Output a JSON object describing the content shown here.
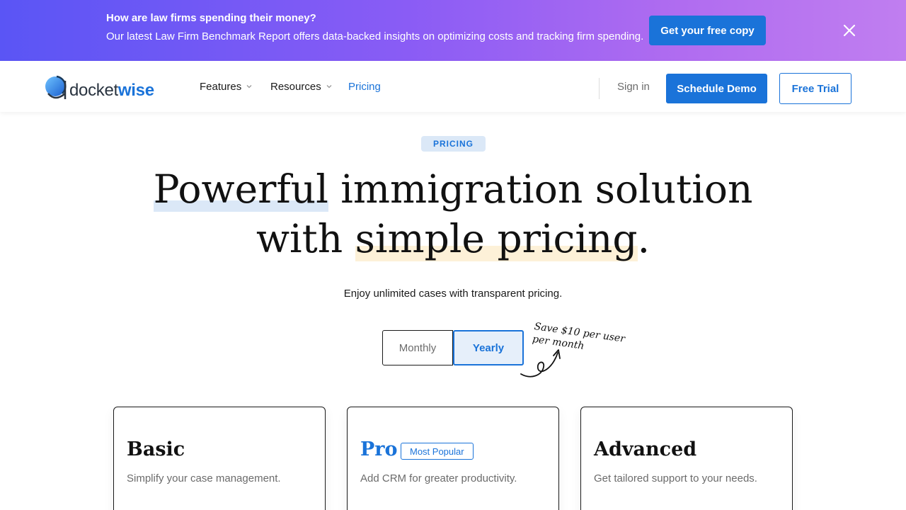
{
  "banner": {
    "title": "How are law firms spending their money?",
    "subtitle": "Our latest Law Firm Benchmark Report offers data-backed insights on optimizing costs and tracking firm spending.",
    "cta": "Get your free copy",
    "close_icon": "close-icon",
    "gradient_start": "#5a55f5",
    "gradient_end": "#c07ef0"
  },
  "header": {
    "logo": {
      "part1": "docket",
      "part2": "wise"
    },
    "nav": [
      {
        "label": "Features",
        "has_dropdown": true
      },
      {
        "label": "Resources",
        "has_dropdown": true
      },
      {
        "label": "Pricing",
        "has_dropdown": false,
        "active": true
      }
    ],
    "signin": "Sign in",
    "demo_button": "Schedule Demo",
    "trial_button": "Free Trial"
  },
  "hero": {
    "pill": "PRICING",
    "title_line1_a": "Powerful",
    "title_line1_b": " immigration solution",
    "title_line2_a": "with ",
    "title_line2_b": "simple pricing",
    "title_line2_c": ".",
    "subtitle": "Enjoy unlimited cases with transparent pricing."
  },
  "billing": {
    "options": [
      "Monthly",
      "Yearly"
    ],
    "selected": "Yearly",
    "savings_note": "Save $10 per user per month"
  },
  "plans": [
    {
      "name": "Basic",
      "description": "Simplify your case management.",
      "badge": ""
    },
    {
      "name": "Pro",
      "description": "Add CRM for greater productivity.",
      "badge": "Most Popular"
    },
    {
      "name": "Advanced",
      "description": "Get tailored support to your needs.",
      "badge": ""
    }
  ],
  "colors": {
    "accent": "#1a73d9",
    "highlight_blue": "#dbe8f7",
    "highlight_yellow": "#fdf1d8"
  }
}
